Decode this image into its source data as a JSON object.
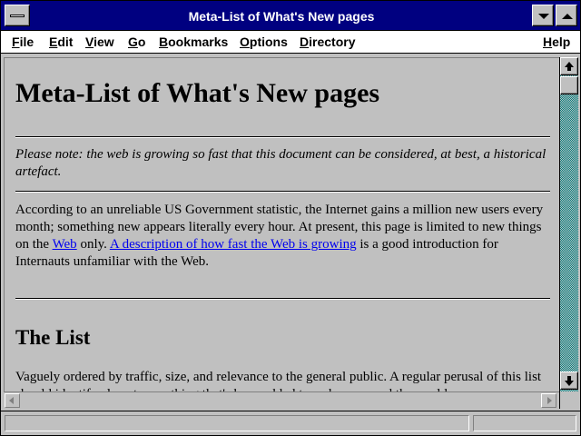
{
  "window": {
    "title": "Meta-List of What's New pages"
  },
  "menubar": {
    "items": [
      {
        "label": "File"
      },
      {
        "label": "Edit"
      },
      {
        "label": "View"
      },
      {
        "label": "Go"
      },
      {
        "label": "Bookmarks"
      },
      {
        "label": "Options"
      },
      {
        "label": "Directory"
      },
      {
        "label": "Help"
      }
    ]
  },
  "page": {
    "heading": "Meta-List of What's New pages",
    "note_lead": "Please note:",
    "note_rest": " the web is growing so fast that this document can be considered, at best, a historical artefact.",
    "para1_a": "According to an unreliable US Government statistic, the Internet gains a million new users every month; something new appears literally every hour. At present, this page is limited to new things on the ",
    "link_web": "Web",
    "para1_b": " only. ",
    "link_growth": "A description of how fast the Web is growing",
    "para1_c": " is a good introduction for Internauts unfamiliar with the Web.",
    "section_heading": "The List",
    "para2": "Vaguely ordered by traffic, size, and relevance to the general public. A regular perusal of this list should identify almost everything that's been added to web space and the world..."
  },
  "status": {
    "text": ""
  },
  "colors": {
    "titlebar": "#000080",
    "link": "#0000ee",
    "background": "#c0c0c0"
  }
}
